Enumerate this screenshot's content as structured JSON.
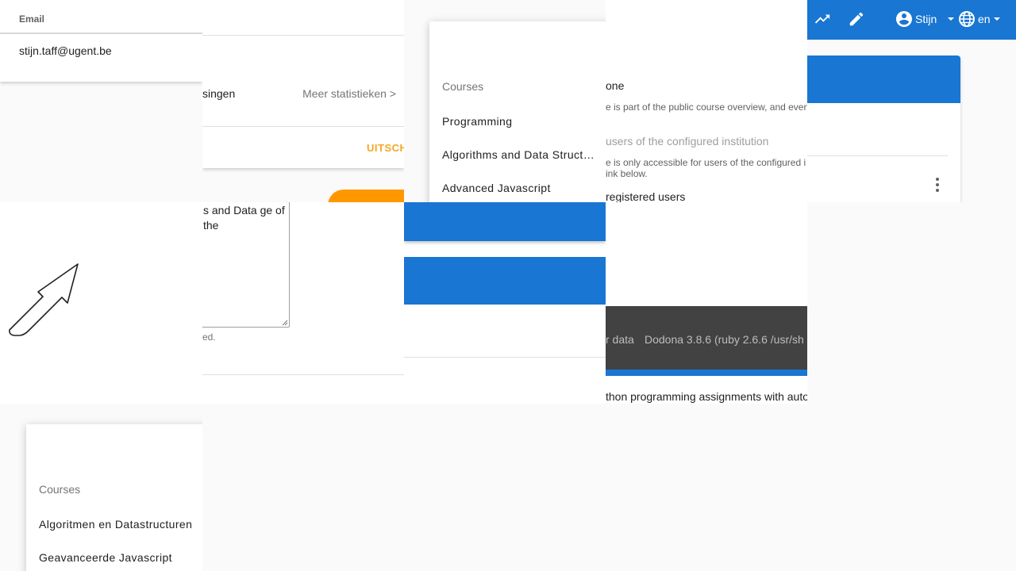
{
  "email": {
    "label": "Email",
    "value": "stijn.taff@ugent.be"
  },
  "stats": {
    "submissions_fragment": "singen",
    "more_stats": "Meer statistieken >",
    "signout_fragment": "UITSCH"
  },
  "courses_menu_en": {
    "header": "Courses",
    "items": [
      "Programming",
      "Algorithms and Data Structures",
      "Advanced Javascript"
    ]
  },
  "visibility": {
    "options": [
      {
        "label": "one",
        "description": "e is part of the public course overview, and every"
      },
      {
        "label": "users of the configured institution",
        "description": "e is only accessible for users of the configured i",
        "description2": "ink below."
      },
      {
        "label": "registered users"
      }
    ]
  },
  "navbar": {
    "user_name": "Stijn",
    "language": "en"
  },
  "description_field": {
    "text": "s and Data ge of the",
    "hint": "ed."
  },
  "footer": {
    "left_fragment": "r data",
    "version": "Dodona 3.8.6 (ruby 2.6.6 /usr/sh",
    "below_text": "thon programming assignments with auto"
  },
  "courses_menu_nl": {
    "header": "Courses",
    "items": [
      "Algoritmen en Datastructuren",
      "Geavanceerde Javascript"
    ]
  },
  "colors": {
    "primary": "#1976d2",
    "accent": "#ff9800",
    "footer": "#424242"
  }
}
